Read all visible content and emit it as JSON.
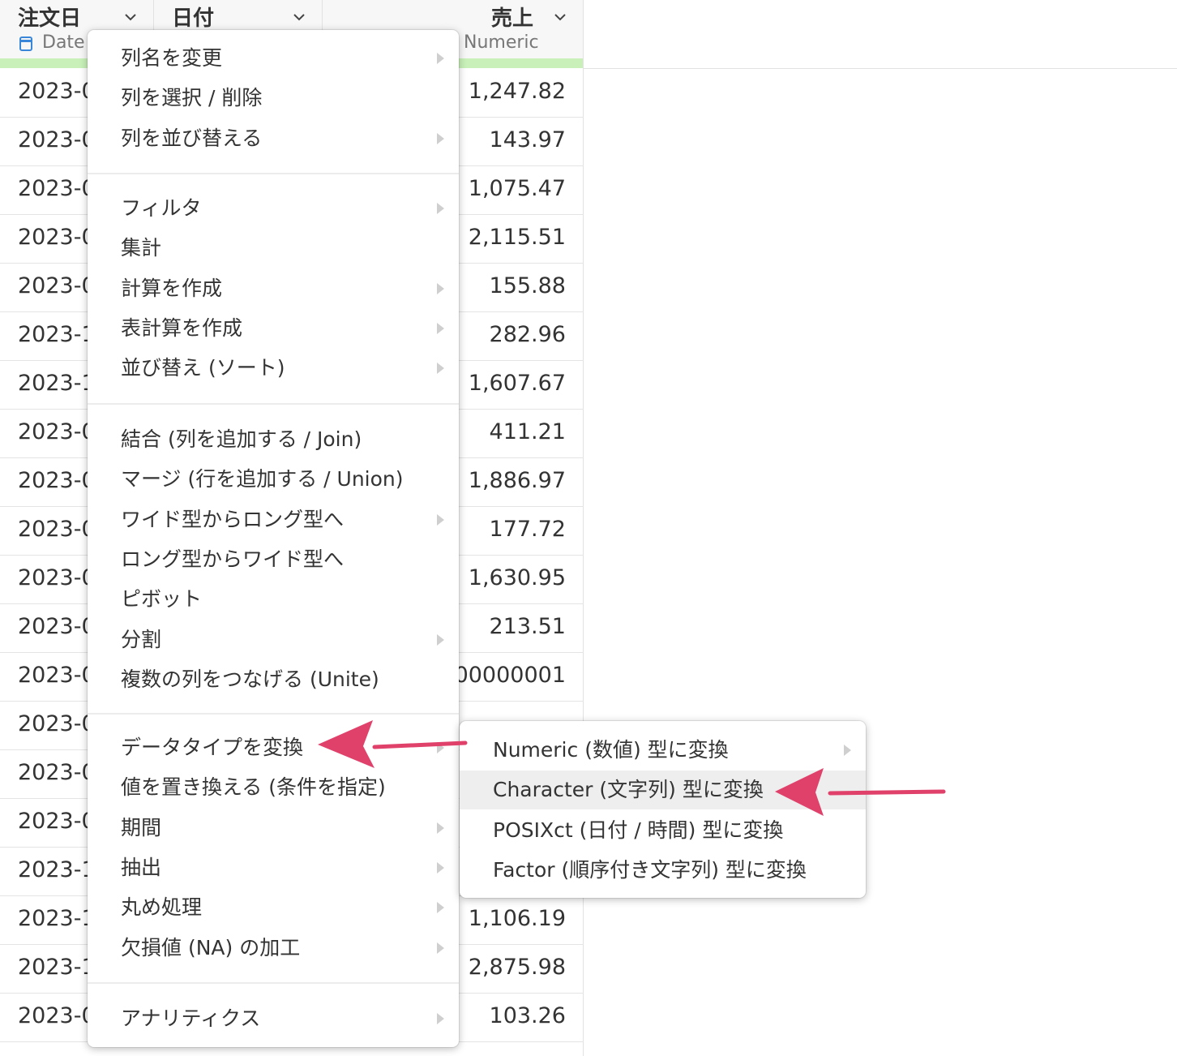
{
  "columns": [
    {
      "title": "注文日",
      "type": "Date",
      "type_icon": "calendar-icon"
    },
    {
      "title": "日付",
      "type": ""
    },
    {
      "title": "売上",
      "type": "Numeric"
    }
  ],
  "rows": [
    {
      "date": "2023-0",
      "sales": "1,247.82"
    },
    {
      "date": "2023-0",
      "sales": "143.97"
    },
    {
      "date": "2023-0",
      "sales": "1,075.47"
    },
    {
      "date": "2023-0",
      "sales": "2,115.51"
    },
    {
      "date": "2023-0",
      "sales": "155.88"
    },
    {
      "date": "2023-1",
      "sales": "282.96"
    },
    {
      "date": "2023-1",
      "sales": "1,607.67"
    },
    {
      "date": "2023-0",
      "sales": "411.21"
    },
    {
      "date": "2023-0",
      "sales": "1,886.97"
    },
    {
      "date": "2023-0",
      "sales": "177.72"
    },
    {
      "date": "2023-0",
      "sales": "1,630.95"
    },
    {
      "date": "2023-0",
      "sales": "213.51"
    },
    {
      "date": "2023-0",
      "sales": ")00000001"
    },
    {
      "date": "2023-0",
      "sales": ""
    },
    {
      "date": "2023-0",
      "sales": ""
    },
    {
      "date": "2023-0",
      "sales": ""
    },
    {
      "date": "2023-1",
      "sales": ""
    },
    {
      "date": "2023-1",
      "sales": "1,106.19"
    },
    {
      "date": "2023-1",
      "sales": "2,875.98"
    },
    {
      "date": "2023-0",
      "sales": "103.26"
    }
  ],
  "main_menu": {
    "groups": [
      [
        {
          "label": "列名を変更",
          "submenu": true
        },
        {
          "label": "列を選択 / 削除",
          "submenu": false
        },
        {
          "label": "列を並び替える",
          "submenu": true
        }
      ],
      [
        {
          "label": "フィルタ",
          "submenu": true
        },
        {
          "label": "集計",
          "submenu": false
        },
        {
          "label": "計算を作成",
          "submenu": true
        },
        {
          "label": "表計算を作成",
          "submenu": true
        },
        {
          "label": "並び替え (ソート)",
          "submenu": true
        }
      ],
      [
        {
          "label": "結合 (列を追加する / Join)",
          "submenu": false
        },
        {
          "label": "マージ (行を追加する / Union)",
          "submenu": false
        },
        {
          "label": "ワイド型からロング型へ",
          "submenu": true
        },
        {
          "label": "ロング型からワイド型へ",
          "submenu": false
        },
        {
          "label": "ピボット",
          "submenu": false
        },
        {
          "label": "分割",
          "submenu": true
        },
        {
          "label": "複数の列をつなげる (Unite)",
          "submenu": false
        }
      ],
      [
        {
          "label": "データタイプを変換",
          "submenu": true
        },
        {
          "label": "値を置き換える (条件を指定)",
          "submenu": false
        },
        {
          "label": "期間",
          "submenu": true
        },
        {
          "label": "抽出",
          "submenu": true
        },
        {
          "label": "丸め処理",
          "submenu": true
        },
        {
          "label": "欠損値 (NA) の加工",
          "submenu": true
        }
      ],
      [
        {
          "label": "アナリティクス",
          "submenu": true
        }
      ]
    ]
  },
  "sub_menu": {
    "items": [
      {
        "label": "Numeric (数値) 型に変換",
        "submenu": true,
        "highlighted": false
      },
      {
        "label": "Character (文字列) 型に変換",
        "submenu": false,
        "highlighted": true
      },
      {
        "label": "POSIXct (日付 / 時間) 型に変換",
        "submenu": false,
        "highlighted": false
      },
      {
        "label": "Factor (順序付き文字列) 型に変換",
        "submenu": false,
        "highlighted": false
      }
    ]
  },
  "colors": {
    "header_bg": "#f7f7f7",
    "header_accent": "#c8f0b8",
    "date_icon": "#3a86d8",
    "annotation_arrow": "#e0416a",
    "highlight_bg": "#eeeeee"
  }
}
